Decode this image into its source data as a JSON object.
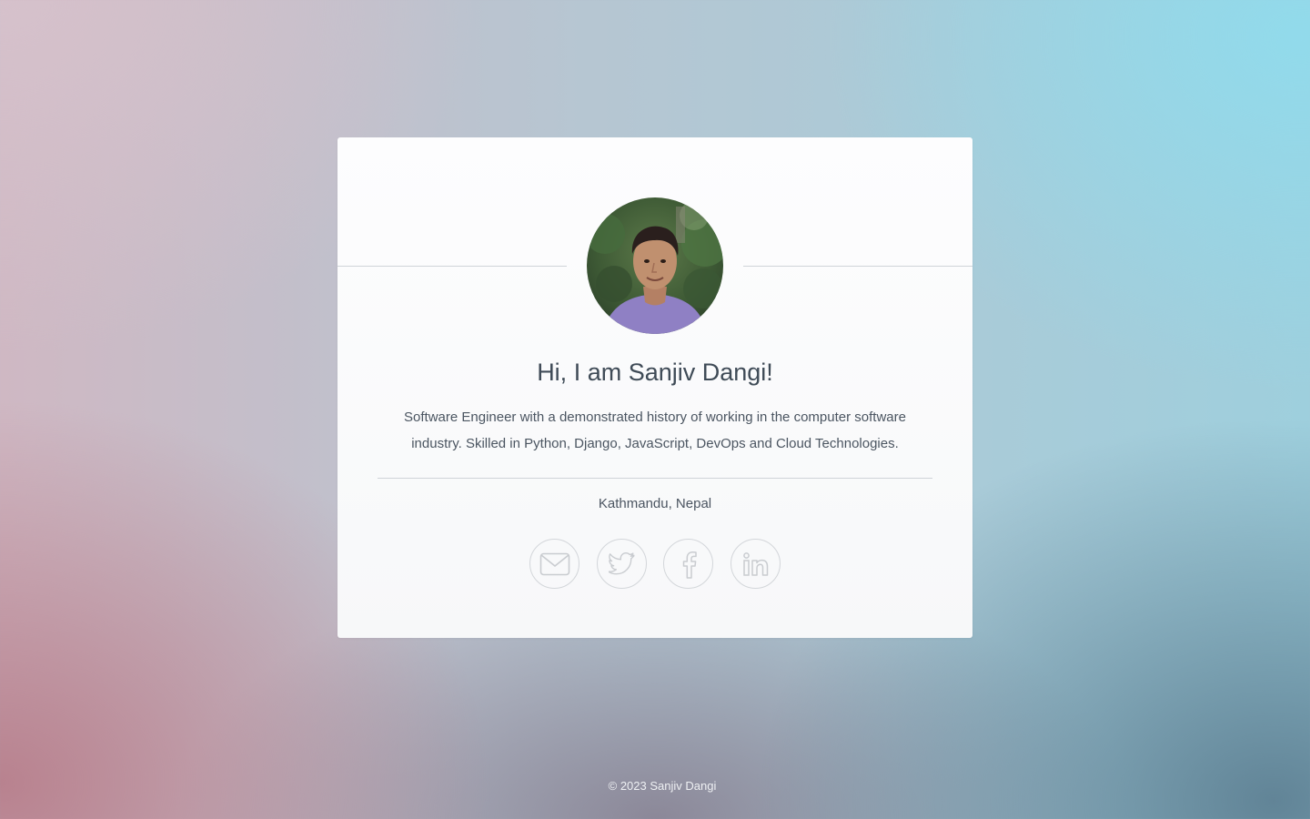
{
  "profile": {
    "greeting": "Hi, I am Sanjiv Dangi!",
    "bio": "Software Engineer with a demonstrated history of working in the computer software industry. Skilled in Python, Django, JavaScript, DevOps and Cloud Technologies.",
    "location": "Kathmandu, Nepal"
  },
  "social": [
    {
      "name": "email",
      "icon": "envelope-icon"
    },
    {
      "name": "twitter",
      "icon": "twitter-bird-icon"
    },
    {
      "name": "facebook",
      "icon": "facebook-f-icon"
    },
    {
      "name": "linkedin",
      "icon": "linkedin-in-icon"
    }
  ],
  "footer": {
    "copyright": "© 2023 Sanjiv Dangi"
  },
  "colors": {
    "text": "#3f4b57",
    "muted": "#4b5561",
    "icon_stroke": "#c9ccd0",
    "card": "#fbfcfc"
  }
}
